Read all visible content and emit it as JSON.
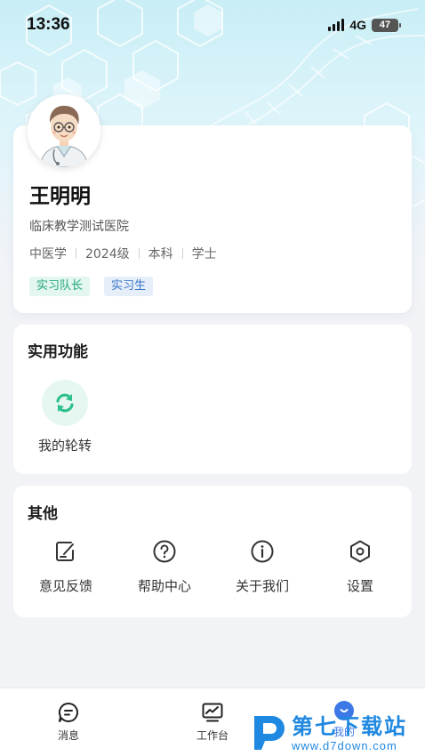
{
  "status_bar": {
    "time": "13:36",
    "network": "4G",
    "battery": "47"
  },
  "profile": {
    "name": "王明明",
    "school": "临床教学测试医院",
    "meta": [
      "中医学",
      "2024级",
      "本科",
      "学士"
    ],
    "tags": [
      "实习队长",
      "实习生"
    ]
  },
  "tools": {
    "title": "实用功能",
    "items": [
      {
        "label": "我的轮转",
        "icon": "rotate-arrows-icon"
      }
    ]
  },
  "other": {
    "title": "其他",
    "items": [
      {
        "label": "意见反馈",
        "icon": "edit-note-icon"
      },
      {
        "label": "帮助中心",
        "icon": "question-circle-icon"
      },
      {
        "label": "关于我们",
        "icon": "info-circle-icon"
      },
      {
        "label": "设置",
        "icon": "hexagon-settings-icon"
      }
    ]
  },
  "tab_bar": {
    "items": [
      {
        "label": "消息",
        "icon": "chat-bubble-icon"
      },
      {
        "label": "工作台",
        "icon": "chart-board-icon"
      },
      {
        "label": "我的",
        "icon": "user-smile-icon",
        "active": true
      }
    ]
  },
  "watermark": {
    "title": "第七下载站",
    "url": "www.d7down.com"
  },
  "colors": {
    "accent_blue": "#3d78e7",
    "tag_green": "#23a97a",
    "tag_blue": "#3d78c7",
    "tool_green": "#2cc08a",
    "watermark_blue": "#1f88e0"
  }
}
